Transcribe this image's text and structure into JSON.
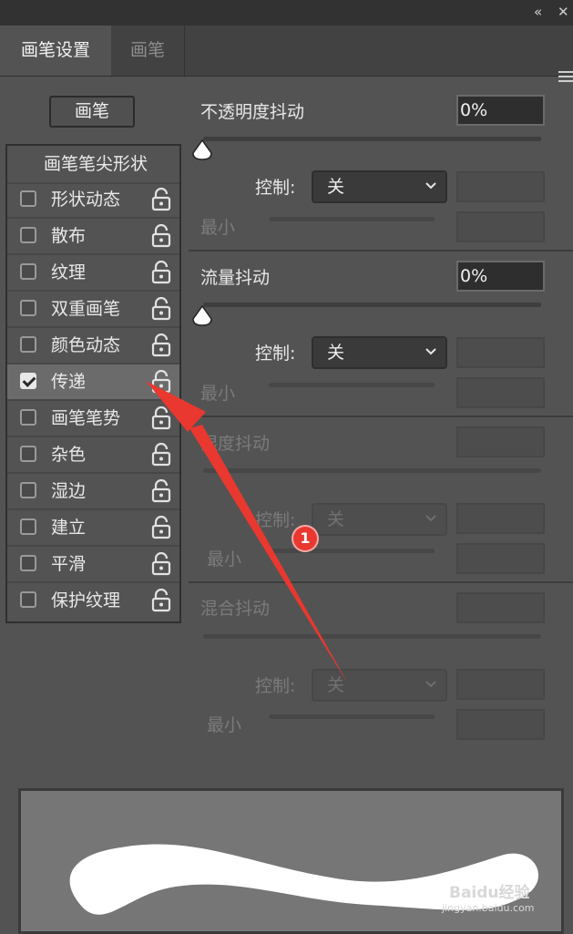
{
  "window": {
    "collapse_icon": "double-chevron-left",
    "close_icon": "close"
  },
  "tabs": [
    {
      "label": "画笔设置",
      "active": true
    },
    {
      "label": "画笔",
      "active": false
    }
  ],
  "preset_button": {
    "label": "画笔"
  },
  "left_list": {
    "header": "画笔笔尖形状",
    "items": [
      {
        "label": "形状动态",
        "checked": false
      },
      {
        "label": "散布",
        "checked": false
      },
      {
        "label": "纹理",
        "checked": false
      },
      {
        "label": "双重画笔",
        "checked": false
      },
      {
        "label": "颜色动态",
        "checked": false
      },
      {
        "label": "传递",
        "checked": true
      },
      {
        "label": "画笔笔势",
        "checked": false
      },
      {
        "label": "杂色",
        "checked": false
      },
      {
        "label": "湿边",
        "checked": false
      },
      {
        "label": "建立",
        "checked": false
      },
      {
        "label": "平滑",
        "checked": false
      },
      {
        "label": "保护纹理",
        "checked": false
      }
    ]
  },
  "right_panel": {
    "opacity_jitter": {
      "label": "不透明度抖动",
      "value": "0%",
      "control_label": "控制:",
      "control_value": "关",
      "min_label": "最小"
    },
    "flow_jitter": {
      "label": "流量抖动",
      "value": "0%",
      "control_label": "控制:",
      "control_value": "关",
      "min_label": "最小"
    },
    "wetness_jitter": {
      "label": "湿度抖动",
      "control_label": "控制:",
      "control_value": "关",
      "min_label": "最小"
    },
    "mix_jitter": {
      "label": "混合抖动",
      "control_label": "控制:",
      "control_value": "关",
      "min_label": "最小"
    }
  },
  "annotation": {
    "badge": "1",
    "color": "#e8382f"
  },
  "watermark": {
    "text": "Baidu经验",
    "subtext": "jingyan.baidu.com"
  },
  "colors": {
    "panel": "#535353",
    "dark": "#323232",
    "accent_red": "#e8382f"
  }
}
